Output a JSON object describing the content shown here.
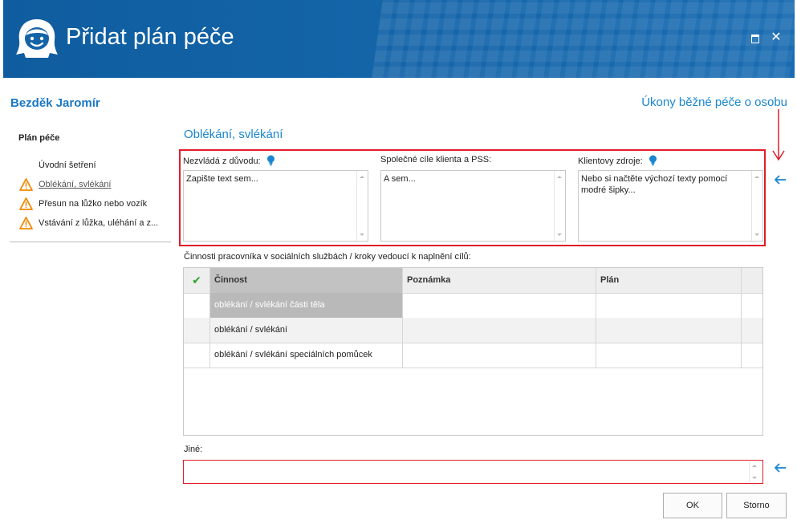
{
  "window": {
    "title": "Přidat plán péče",
    "maximize_icon": "maximize-icon",
    "close_icon": "close-icon",
    "close_glyph": "✕",
    "accent": "#1363a7"
  },
  "header": {
    "client_name": "Bezděk Jaromír",
    "section_link": "Úkony běžné péče o osobu"
  },
  "sidebar": {
    "title": "Plán péče",
    "items": [
      {
        "label": "Úvodní šetření",
        "icon": ""
      },
      {
        "label": "Oblékání, svlékání",
        "icon": "warning-icon",
        "active": true
      },
      {
        "label": "Přesun na lůžko nebo vozík",
        "icon": "warning-icon"
      },
      {
        "label": "Vstávání z lůžka, uléhání a z...",
        "icon": "warning-icon"
      }
    ]
  },
  "main": {
    "subsection_title": "Oblékání, svlékání",
    "fields": [
      {
        "label": "Nezvládá z důvodu:",
        "value": "Zapište text sem...",
        "hint_icon": "lightbulb-icon"
      },
      {
        "label": "Společné cíle klienta a PSS:",
        "value": "A sem...",
        "hint_icon": ""
      },
      {
        "label": "Klientovy zdroje:",
        "value": "Nebo si načtěte výchozí texty pomocí modré šipky...",
        "hint_icon": "lightbulb-icon"
      }
    ],
    "activities_label": "Činnosti pracovníka v sociálních službách / kroky vedoucí k naplnění cílů:",
    "table": {
      "columns": [
        "",
        "Činnost",
        "Poznámka",
        "Plán"
      ],
      "check_glyph": "✔",
      "rows": [
        {
          "activity": "oblékání / svlékání části těla",
          "note": "",
          "plan": "",
          "selected": true
        },
        {
          "activity": "oblékání / svlékání",
          "note": "",
          "plan": ""
        },
        {
          "activity": "oblékání / svlékání speciálních pomůcek",
          "note": "",
          "plan": ""
        }
      ]
    },
    "other_label": "Jiné:",
    "other_value": ""
  },
  "buttons": {
    "ok": "OK",
    "cancel": "Storno"
  },
  "colors": {
    "link_blue": "#1a86cf",
    "error_red": "#e11d28",
    "arrow_blue": "#1a86cf"
  }
}
